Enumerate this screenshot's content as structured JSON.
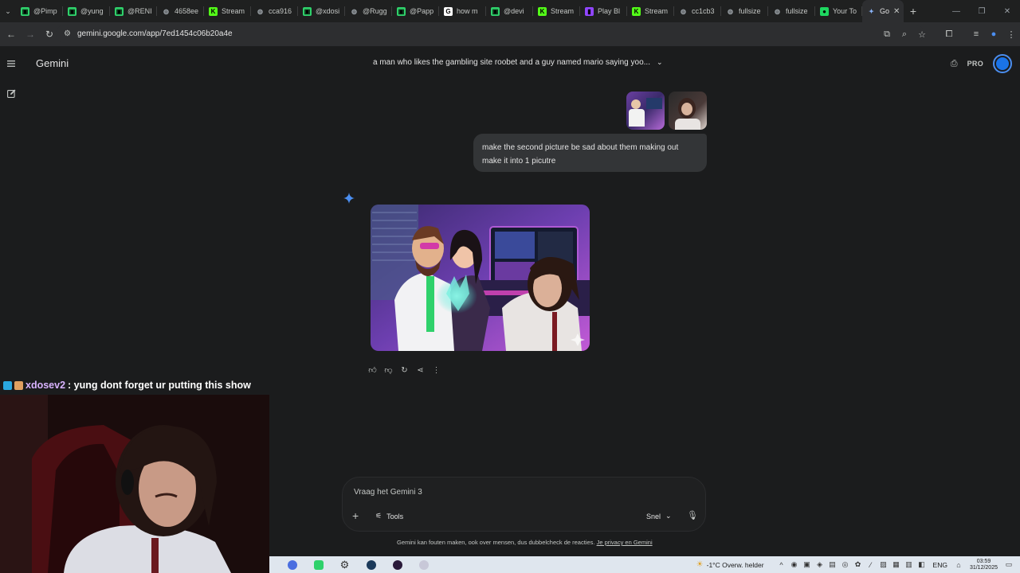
{
  "browser": {
    "tabs": [
      {
        "label": "@Pimp",
        "icon": "channel-icon",
        "color": "#2fd16b"
      },
      {
        "label": "@yung",
        "icon": "channel-icon",
        "color": "#2fd16b"
      },
      {
        "label": "@RENI",
        "icon": "channel-icon",
        "color": "#2fd16b"
      },
      {
        "label": "4658ee",
        "icon": "globe-icon",
        "color": "#9aa0a6"
      },
      {
        "label": "Stream",
        "icon": "kick-icon",
        "color": "#53fc18"
      },
      {
        "label": "cca916",
        "icon": "globe-icon",
        "color": "#9aa0a6"
      },
      {
        "label": "@xdosi",
        "icon": "channel-icon",
        "color": "#2fd16b"
      },
      {
        "label": "@Rugg",
        "icon": "globe-icon",
        "color": "#9aa0a6"
      },
      {
        "label": "@Papp",
        "icon": "channel-icon",
        "color": "#2fd16b"
      },
      {
        "label": "how m",
        "icon": "google-icon",
        "color": "#ffffff"
      },
      {
        "label": "@devi",
        "icon": "channel-icon",
        "color": "#2fd16b"
      },
      {
        "label": "Stream",
        "icon": "kick-icon",
        "color": "#53fc18"
      },
      {
        "label": "Play Bl",
        "icon": "twitch-icon",
        "color": "#9146ff"
      },
      {
        "label": "Stream",
        "icon": "kick-icon",
        "color": "#53fc18"
      },
      {
        "label": "cc1cb3",
        "icon": "globe-icon",
        "color": "#9aa0a6"
      },
      {
        "label": "fullsize",
        "icon": "globe-icon",
        "color": "#9aa0a6"
      },
      {
        "label": "fullsize",
        "icon": "globe-icon",
        "color": "#9aa0a6"
      },
      {
        "label": "Your To",
        "icon": "spotify-icon",
        "color": "#1ed760"
      }
    ],
    "active_tab": {
      "label": "Go",
      "icon": "gemini-icon"
    },
    "url": "gemini.google.com/app/7ed1454c06b20a4e"
  },
  "gemini": {
    "brand": "Gemini",
    "conversation_title": "a man who likes the gambling site roobet and a guy named mario saying yoo...",
    "pro_label": "PRO",
    "user_message": "make the second picture be sad about them making out make it into 1 picutre",
    "input_placeholder": "Vraag het Gemini 3",
    "tools_label": "Tools",
    "mode_label": "Snel",
    "disclaimer": "Gemini kan fouten maken, ook over mensen, dus dubbelcheck de reacties.",
    "privacy_link": "Je privacy en Gemini"
  },
  "overlay": {
    "chat_user": "xdosev2",
    "chat_message": ": yung dont forget ur putting this show"
  },
  "taskbar": {
    "weather": "-1°C  Overw. helder",
    "lang": "ENG",
    "time": "03:59",
    "date": "31/12/2025"
  }
}
